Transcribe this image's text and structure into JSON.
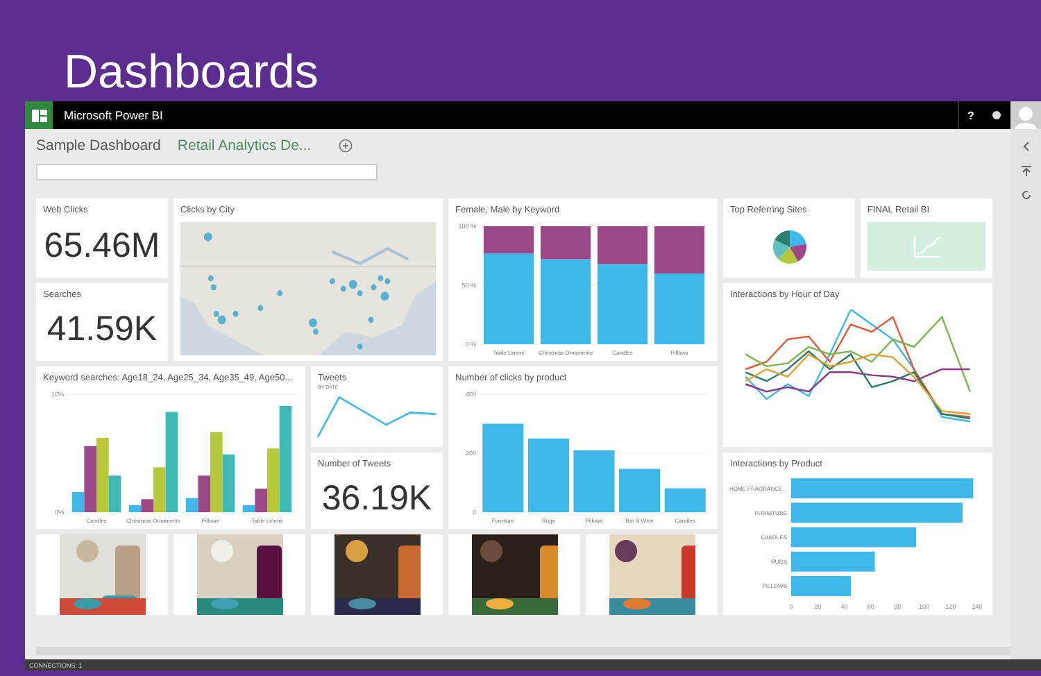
{
  "slide": {
    "title": "Dashboards"
  },
  "app_bar": {
    "title": "Microsoft Power BI",
    "help": "?"
  },
  "tabs": [
    {
      "label": "Sample Dashboard",
      "selected": false
    },
    {
      "label": "Retail Analytics De...",
      "selected": true
    }
  ],
  "tiles": [
    {
      "kind": "card",
      "title": "Web Clicks",
      "value": "65.46M"
    },
    {
      "kind": "map",
      "title": "Clicks by City"
    },
    {
      "kind": "chart",
      "title": "Female, Male by Keyword",
      "chart_data": {
        "type": "bar",
        "stacked": true,
        "categories": [
          "Table Linens",
          "Christmas Ornaments",
          "Candles",
          "Pillows"
        ],
        "ylim": [
          0,
          100
        ],
        "yticks": [
          {
            "value": 0,
            "label": "0 %"
          },
          {
            "value": 50,
            "label": "50 %"
          },
          {
            "value": 100,
            "label": "100 %"
          }
        ],
        "series": [
          {
            "color": "#3fb7e9",
            "values": [
              77,
              72,
              68,
              60
            ]
          },
          {
            "color": "#9c4788",
            "values": [
              23,
              28,
              32,
              40
            ]
          }
        ]
      }
    },
    {
      "kind": "pie",
      "title": "Top Referring Sites"
    },
    {
      "kind": "report",
      "title": "FINAL Retail BI"
    },
    {
      "kind": "card",
      "title": "Searches",
      "value": "41.59K"
    },
    {
      "kind": "lines",
      "title": "Interactions by Hour of Day"
    },
    {
      "kind": "chart",
      "title": "Keyword searches: Age18_24, Age25_34, Age35_49, Age50...",
      "chart_data": {
        "type": "bar",
        "categories": [
          "Candles",
          "Christmas Ornaments",
          "Pillows",
          "Table Linens"
        ],
        "ylim": [
          0,
          10
        ],
        "yticks": [
          {
            "value": 0,
            "label": "0%"
          },
          {
            "value": 10,
            "label": "10%"
          }
        ],
        "series": [
          {
            "color": "#3fb7e9",
            "values": [
              1.7,
              0.6,
              1.2,
              0.6
            ]
          },
          {
            "color": "#9c4788",
            "values": [
              5.6,
              1.1,
              3.1,
              2.0
            ]
          },
          {
            "color": "#b7c83b",
            "values": [
              6.3,
              3.8,
              6.8,
              5.4
            ]
          },
          {
            "color": "#3fb9b5",
            "values": [
              3.1,
              8.5,
              4.9,
              9.0
            ]
          }
        ]
      }
    },
    {
      "kind": "sparkline",
      "title": "Tweets",
      "subtitle": "BY DATE"
    },
    {
      "kind": "chart",
      "title": "Number of clicks by product",
      "chart_data": {
        "type": "bar",
        "categories": [
          "Furniture",
          "Rugs",
          "Pillows",
          "Bar & Wine",
          "Candles"
        ],
        "ylim": [
          0,
          400
        ],
        "yticks": [
          0,
          200,
          400
        ],
        "series": [
          {
            "color": "#3fb7e9",
            "values": [
              300,
              250,
              210,
              147,
              81
            ]
          }
        ]
      }
    },
    {
      "kind": "card",
      "title": "Number of Tweets",
      "value": "36.19K"
    },
    {
      "kind": "chart",
      "title": "Interactions by Product",
      "chart_data": {
        "type": "bar",
        "orientation": "horizontal",
        "categories": [
          "HOME FRAGRANCE...",
          "FURNITURE",
          "CANDLES",
          "RUGS",
          "PILLOWS"
        ],
        "xlim": [
          0,
          140
        ],
        "xticks": [
          0,
          20,
          40,
          60,
          80,
          100,
          120,
          140
        ],
        "series": [
          {
            "color": "#3fb7e9",
            "values": [
              137,
              129,
              94,
              63,
              45
            ]
          }
        ]
      }
    },
    {
      "kind": "picture"
    },
    {
      "kind": "picture"
    },
    {
      "kind": "picture"
    },
    {
      "kind": "picture"
    },
    {
      "kind": "picture"
    }
  ],
  "status_bar": {
    "text": "CONNECTIONS: 1"
  }
}
